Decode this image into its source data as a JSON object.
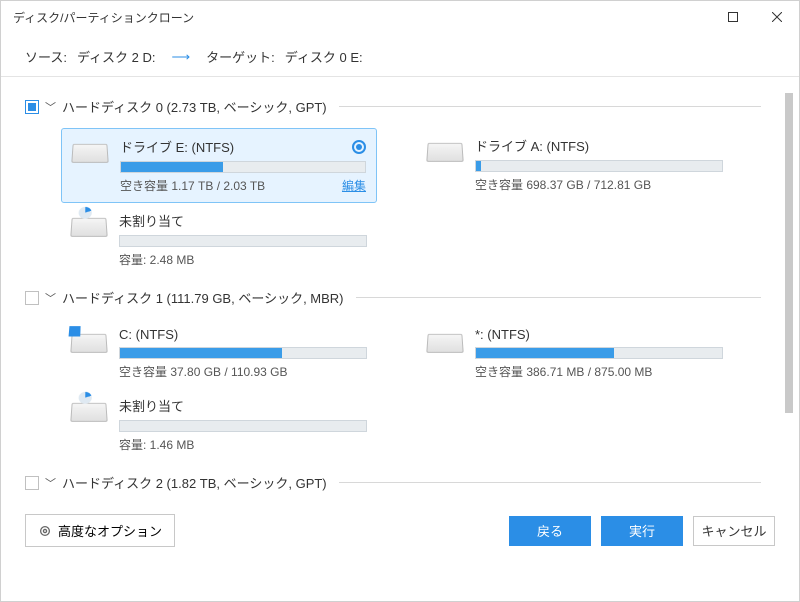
{
  "window": {
    "title": "ディスク/パーティションクローン"
  },
  "header": {
    "source_label": "ソース:",
    "source_value": "ディスク 2 D:",
    "target_label": "ターゲット:",
    "target_value": "ディスク 0 E:"
  },
  "disks": [
    {
      "checked": "partial",
      "label": "ハードディスク 0 (2.73 TB, ベーシック, GPT)",
      "partitions": [
        {
          "name": "ドライブ E: (NTFS)",
          "selected": true,
          "fill_pct": 42,
          "stat": "空き容量 1.17 TB / 2.03 TB",
          "edit": "編集",
          "icon": "plain"
        },
        {
          "name": "ドライブ A: (NTFS)",
          "fill_pct": 2,
          "stat": "空き容量 698.37 GB / 712.81 GB",
          "icon": "plain"
        },
        {
          "name": "未割り当て",
          "fill_pct": 0,
          "stat": "容量: 2.48 MB",
          "icon": "pie"
        }
      ]
    },
    {
      "checked": "none",
      "label": "ハードディスク 1 (111.79 GB, ベーシック, MBR)",
      "partitions": [
        {
          "name": "C: (NTFS)",
          "fill_pct": 66,
          "stat": "空き容量 37.80 GB / 110.93 GB",
          "icon": "win"
        },
        {
          "name": "*: (NTFS)",
          "fill_pct": 56,
          "stat": "空き容量 386.71 MB / 875.00 MB",
          "icon": "plain"
        },
        {
          "name": "未割り当て",
          "fill_pct": 0,
          "stat": "容量: 1.46 MB",
          "icon": "pie"
        }
      ]
    },
    {
      "checked": "none",
      "label": "ハードディスク 2 (1.82 TB, ベーシック, GPT)",
      "partitions": []
    }
  ],
  "footer": {
    "advanced": "高度なオプション",
    "back": "戻る",
    "execute": "実行",
    "cancel": "キャンセル"
  }
}
